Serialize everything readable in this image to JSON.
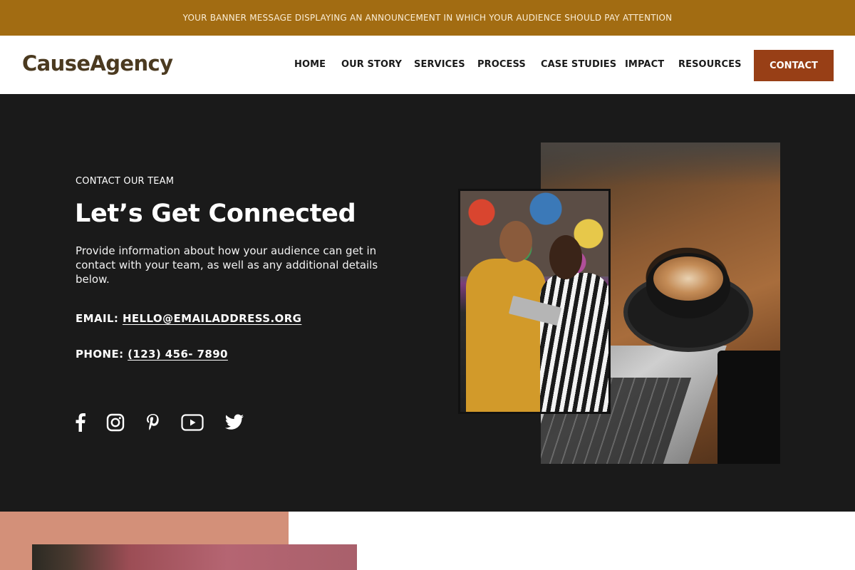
{
  "banner": {
    "text": "YOUR BANNER MESSAGE DISPLAYING AN ANNOUNCEMENT IN WHICH YOUR AUDIENCE SHOULD PAY ATTENTION"
  },
  "header": {
    "logo": "CauseAgency",
    "nav": [
      "HOME",
      "OUR STORY",
      "SERVICES",
      "PROCESS",
      "CASE STUDIES",
      "IMPACT",
      "RESOURCES"
    ],
    "contact_button": "CONTACT"
  },
  "hero": {
    "eyebrow": "CONTACT OUR TEAM",
    "title": "Let’s Get Connected",
    "description": "Provide information about how your audience can get in contact with your team, as well as any additional details below.",
    "email_label": "EMAIL:",
    "email_value": "HELLO@EMAILADDRESS.ORG",
    "phone_label": "PHONE:",
    "phone_value": "(123) 456- 7890",
    "social_icons": [
      "facebook-icon",
      "instagram-icon",
      "pinterest-icon",
      "youtube-icon",
      "twitter-icon"
    ]
  },
  "colors": {
    "banner_bg": "#a26c12",
    "logo": "#4b3a20",
    "contact_button_bg": "#983f16",
    "hero_bg": "#1a1a1a",
    "bottom_band": "#d39079"
  }
}
